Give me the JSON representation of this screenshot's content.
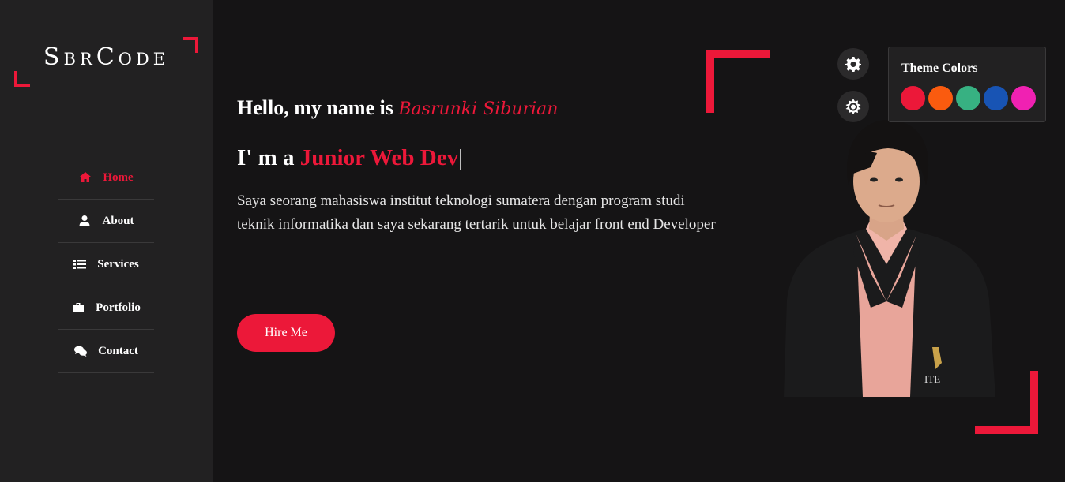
{
  "sidebar": {
    "logo": "SbrCode",
    "nav": [
      {
        "label": "Home",
        "icon": "home-icon",
        "active": true
      },
      {
        "label": "About",
        "icon": "user-icon",
        "active": false
      },
      {
        "label": "Services",
        "icon": "list-icon",
        "active": false
      },
      {
        "label": "Portfolio",
        "icon": "briefcase-icon",
        "active": false
      },
      {
        "label": "Contact",
        "icon": "comments-icon",
        "active": false
      }
    ]
  },
  "hero": {
    "greeting": "Hello, my name is",
    "name": "Basrunki Siburian",
    "role_prefix": "I' m a",
    "role": "Junior Web Dev",
    "description": "Saya seorang mahasiswa institut teknologi sumatera dengan program studi teknik informatika dan saya sekarang tertarik untuk belajar front end Developer",
    "button": "Hire Me",
    "photo_caption": "ITE"
  },
  "switcher": {
    "title": "Theme Colors",
    "colors": [
      "#ec1839",
      "#fa5b0f",
      "#37b182",
      "#1854b4",
      "#f021b2"
    ]
  },
  "colors": {
    "accent": "#ec1839",
    "background": "#151415",
    "sidebar": "#222122"
  }
}
